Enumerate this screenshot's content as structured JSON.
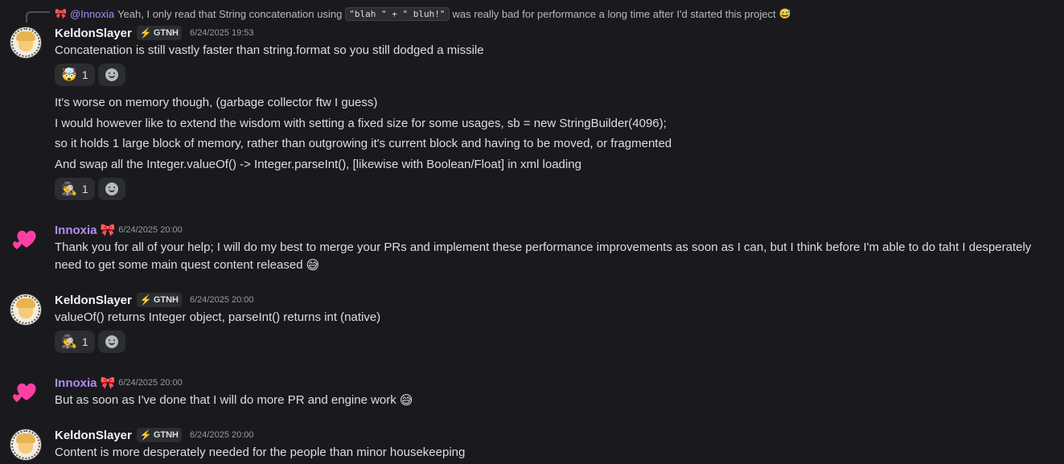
{
  "reply": {
    "mention": "@Innoxia",
    "text_before": "Yeah, I only read that String concatenation using",
    "code": "\"blah \" + \" bluh!\"",
    "text_after": "was really bad for performance a long time after I'd started this project",
    "icon": "ribbon-icon",
    "end_emoji": "sweat-smile-icon"
  },
  "users": {
    "keldon": {
      "name": "KeldonSlayer",
      "tag": "GTNH",
      "avatar": "anime-coffee-avatar"
    },
    "innoxia": {
      "name": "Innoxia",
      "avatar": "pink-hearts-avatar"
    }
  },
  "messages": [
    {
      "timestamp": "6/24/2025 19:53",
      "lines": [
        "Concatenation is still vastly faster than string.format so you still dodged a missile"
      ],
      "reaction": {
        "emoji": "mind-blown-icon",
        "count": "1"
      }
    },
    {
      "lines": [
        "It's worse on memory though, (garbage collector ftw I guess)",
        "I would however like to extend the wisdom with setting a fixed size for some usages, sb = new StringBuilder(4096);",
        "so it holds 1 large block of memory, rather than outgrowing it's current block and having to be moved, or fragmented",
        "And swap all the Integer.valueOf() -> Integer.parseInt(), [likewise with Boolean/Float] in xml loading"
      ],
      "reaction": {
        "emoji": "detective-icon",
        "count": "1"
      }
    },
    {
      "timestamp": "6/24/2025 20:00",
      "lines": [
        "Thank you for all of your help; I will do my best to merge your PRs and implement these performance improvements as soon as I can, but I think before I'm able to do taht I desperately",
        "need to get some main quest content released"
      ]
    },
    {
      "timestamp": "6/24/2025 20:00",
      "lines": [
        "valueOf() returns Integer object, parseInt() returns int (native)"
      ],
      "reaction": {
        "emoji": "detective-icon",
        "count": "1"
      }
    },
    {
      "timestamp": "6/24/2025 20:00",
      "lines": [
        "But as soon as I've done that I will do more PR and engine work"
      ]
    },
    {
      "timestamp": "6/24/2025 20:00",
      "lines": [
        "Content is more desperately needed for the people than minor housekeeping"
      ]
    }
  ],
  "colors": {
    "background": "#1a1a1e",
    "innoxia_name": "#b18cf0",
    "mention": "#a78bfa",
    "heart": "#ff3fa4"
  }
}
